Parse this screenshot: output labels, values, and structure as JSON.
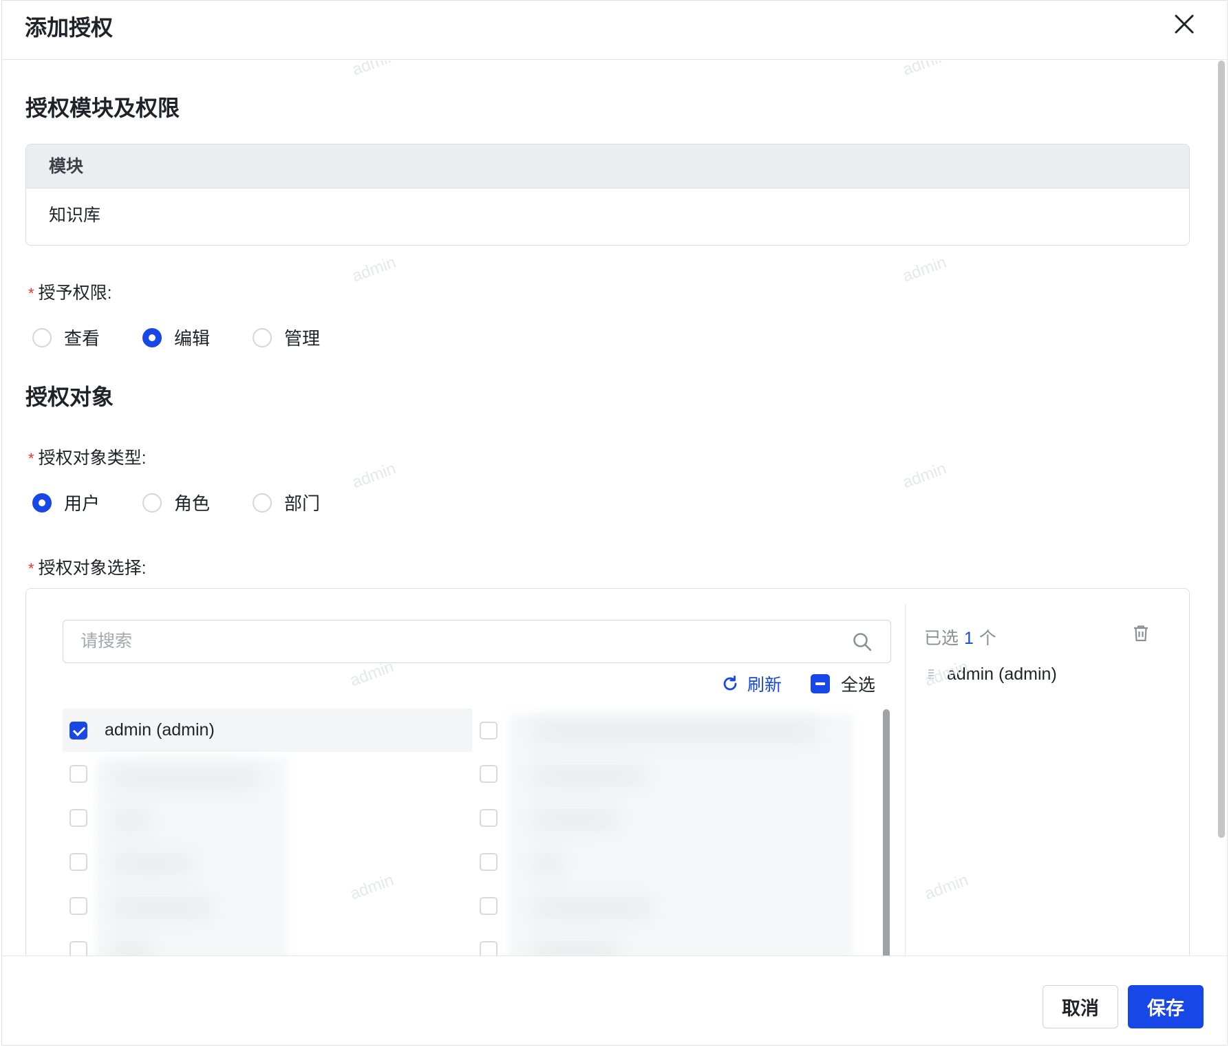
{
  "dialog": {
    "title": "添加授权"
  },
  "section_module": {
    "title": "授权模块及权限",
    "table_header": "模块",
    "rows": [
      "知识库"
    ]
  },
  "permission": {
    "label": "授予权限:",
    "options": [
      "查看",
      "编辑",
      "管理"
    ],
    "selected": "编辑"
  },
  "section_target": {
    "title": "授权对象"
  },
  "target_type": {
    "label": "授权对象类型:",
    "options": [
      "用户",
      "角色",
      "部门"
    ],
    "selected": "用户"
  },
  "target_select": {
    "label": "授权对象选择:",
    "search_placeholder": "请搜索",
    "refresh_label": "刷新",
    "select_all_label": "全选",
    "items": [
      {
        "name": "admin (admin)",
        "checked": true
      }
    ],
    "selected_prefix": "已选",
    "selected_count": "1",
    "selected_suffix": "个",
    "selected_items": [
      "admin (admin)"
    ]
  },
  "footer": {
    "cancel_label": "取消",
    "save_label": "保存"
  },
  "watermark": "admin",
  "colors": {
    "primary": "#1747e6",
    "required": "#e5342b"
  }
}
